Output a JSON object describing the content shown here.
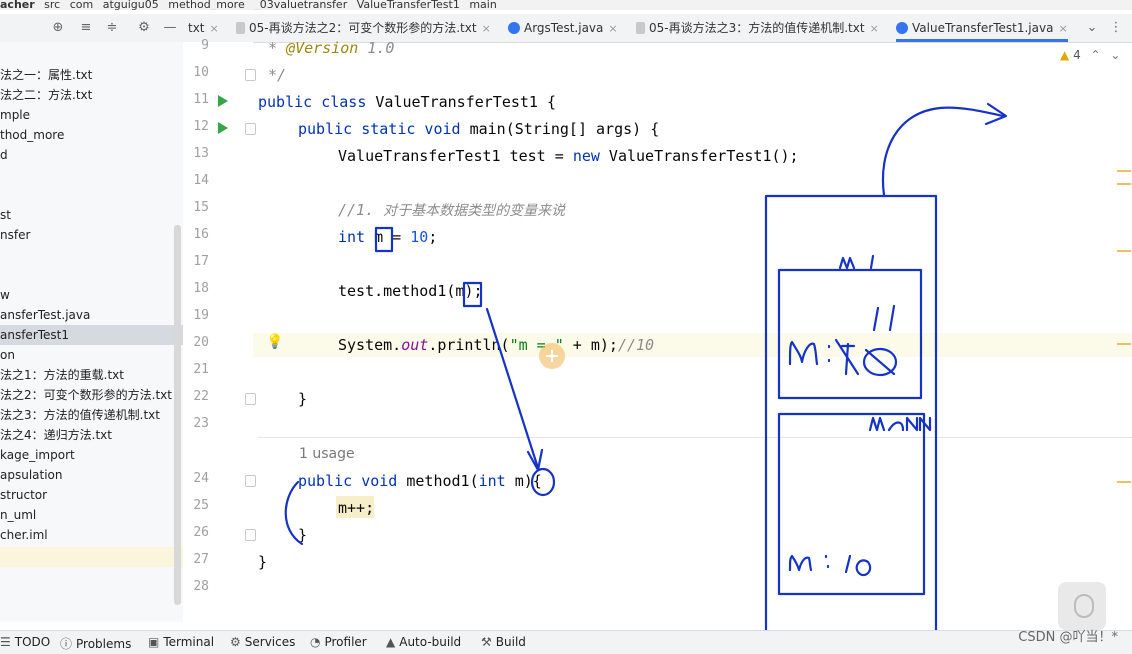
{
  "breadcrumb": [
    "acher",
    "src",
    "com",
    "atguigu05",
    "method_more",
    "_03valuetransfer",
    "ValueTransferTest1",
    "main"
  ],
  "tabs": [
    {
      "label": "txt",
      "active": false
    },
    {
      "label": "05-再谈方法之2：可变个数形参的方法.txt",
      "active": false
    },
    {
      "label": "ArgsTest.java",
      "active": false
    },
    {
      "label": "05-再谈方法之3：方法的值传递机制.txt",
      "active": false
    },
    {
      "label": "ValueTransferTest1.java",
      "active": true
    }
  ],
  "project_tree": [
    "法之一：属性.txt",
    "法之二：方法.txt",
    "mple",
    "thod_more",
    "d",
    "",
    "",
    "st",
    "nsfer",
    "",
    "",
    "w",
    "ansferTest.java",
    "ansferTest1",
    "on",
    "法之1：方法的重载.txt",
    "法之2：可变个数形参的方法.txt",
    "法之3：方法的值传递机制.txt",
    "法之4：递归方法.txt",
    "kage_import",
    "apsulation",
    "structor",
    "n_uml",
    "cher.iml"
  ],
  "editor": {
    "line_numbers": [
      "9",
      "10",
      "11",
      "12",
      "13",
      "14",
      "15",
      "16",
      "17",
      "18",
      "19",
      "20",
      "21",
      "22",
      "23",
      "24",
      "25",
      "26",
      "27",
      "28"
    ],
    "code": {
      "l9_star": "* ",
      "l9_ann": "@Version",
      "l9_ver": " 1.0",
      "l10": "*/",
      "l11_kw": "public class",
      "l11_rest": " ValueTransferTest1 {",
      "l12_kw": "public static void",
      "l12_rest": " main(String[] args) {",
      "l13_a": "ValueTransferTest1 test = ",
      "l13_kw": "new",
      "l13_b": " ValueTransferTest1();",
      "l15_comment": "//1. ",
      "l15_comment_cn": "对于基本数据类型的变量来说",
      "l16_kw": "int",
      "l16_var": "m",
      "l16_eq": " = ",
      "l16_num": "10",
      "l16_end": ";",
      "l18_a": "test.method1(",
      "l18_var": "m",
      "l18_b": ");",
      "l20_a": "System.",
      "l20_field": "out",
      "l20_b": ".println(",
      "l20_str": "\"m = \"",
      "l20_c": " + m);",
      "l20_comment": "//10",
      "l22": "}",
      "usage": "1 usage",
      "l24_kw1": "public void",
      "l24_a": " method1(",
      "l24_kw2": "int",
      "l24_sp": " ",
      "l24_var": "m",
      "l24_b": "){",
      "l25": "m++;",
      "l26": "}",
      "l27": "}"
    }
  },
  "right_status": {
    "warnings": "4"
  },
  "bottom_tools": [
    {
      "label": "TODO",
      "icon": "list-icon"
    },
    {
      "label": "Problems",
      "icon": "problems-icon"
    },
    {
      "label": "Terminal",
      "icon": "terminal-icon"
    },
    {
      "label": "Services",
      "icon": "services-icon"
    },
    {
      "label": "Profiler",
      "icon": "profiler-icon"
    },
    {
      "label": "Auto-build",
      "icon": "auto-build-icon"
    },
    {
      "label": "Build",
      "icon": "build-icon"
    }
  ],
  "annotations": {
    "frame_top_label": "m1",
    "frame_top_value": "m: 10→11",
    "frame_bottom_label": "main",
    "frame_bottom_value": "m: 10"
  },
  "watermark": "CSDN @吖当！*",
  "colors": {
    "accent": "#3574f0",
    "run_green": "#3aa34a",
    "ink_blue": "#1533c8"
  }
}
